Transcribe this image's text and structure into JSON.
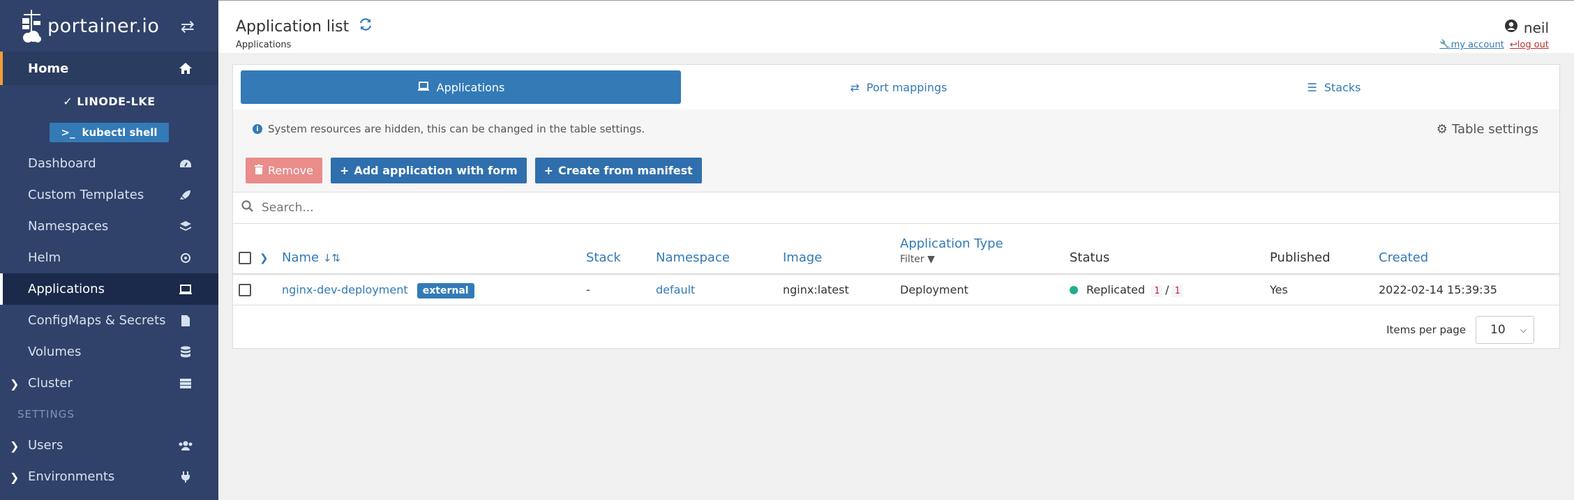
{
  "brand": {
    "name": "portainer.io"
  },
  "sidebar": {
    "home": "Home",
    "environment": "LINODE-LKE",
    "kubectl": "kubectl shell",
    "items": [
      {
        "label": "Dashboard",
        "icon": "tachometer-icon"
      },
      {
        "label": "Custom Templates",
        "icon": "rocket-icon"
      },
      {
        "label": "Namespaces",
        "icon": "layers-icon"
      },
      {
        "label": "Helm",
        "icon": "helm-icon"
      },
      {
        "label": "Applications",
        "icon": "laptop-code-icon"
      },
      {
        "label": "ConfigMaps & Secrets",
        "icon": "file-code-icon"
      },
      {
        "label": "Volumes",
        "icon": "database-icon"
      },
      {
        "label": "Cluster",
        "icon": "server-icon"
      }
    ],
    "settings_header": "SETTINGS",
    "settings_items": [
      {
        "label": "Users",
        "icon": "users-icon"
      },
      {
        "label": "Environments",
        "icon": "plug-icon"
      }
    ]
  },
  "header": {
    "title": "Application list",
    "breadcrumb": "Applications",
    "user": "neil",
    "my_account": "my account",
    "log_out": "log out"
  },
  "tabs": [
    {
      "label": "Applications",
      "active": true
    },
    {
      "label": "Port mappings",
      "active": false
    },
    {
      "label": "Stacks",
      "active": false
    }
  ],
  "info": {
    "message": "System resources are hidden, this can be changed in the table settings.",
    "table_settings": "Table settings"
  },
  "actions": {
    "remove": "Remove",
    "add_form": "Add application with form",
    "create_manifest": "Create from manifest"
  },
  "search": {
    "placeholder": "Search..."
  },
  "table": {
    "columns": {
      "name": "Name",
      "stack": "Stack",
      "namespace": "Namespace",
      "image": "Image",
      "type": "Application Type",
      "filter": "Filter",
      "status": "Status",
      "published": "Published",
      "created": "Created"
    },
    "rows": [
      {
        "name": "nginx-dev-deployment",
        "badge": "external",
        "stack": "-",
        "namespace": "default",
        "image": "nginx:latest",
        "type": "Deployment",
        "status": "Replicated",
        "replicas_running": "1",
        "replicas_sep": "/",
        "replicas_total": "1",
        "published": "Yes",
        "created": "2022-02-14 15:39:35"
      }
    ]
  },
  "pagination": {
    "label": "Items per page",
    "value": "10"
  },
  "colors": {
    "sidebar": "#30426a",
    "primary": "#337ab7",
    "danger": "#e98c8a",
    "success": "#23ae89",
    "accent": "#f19d38"
  }
}
